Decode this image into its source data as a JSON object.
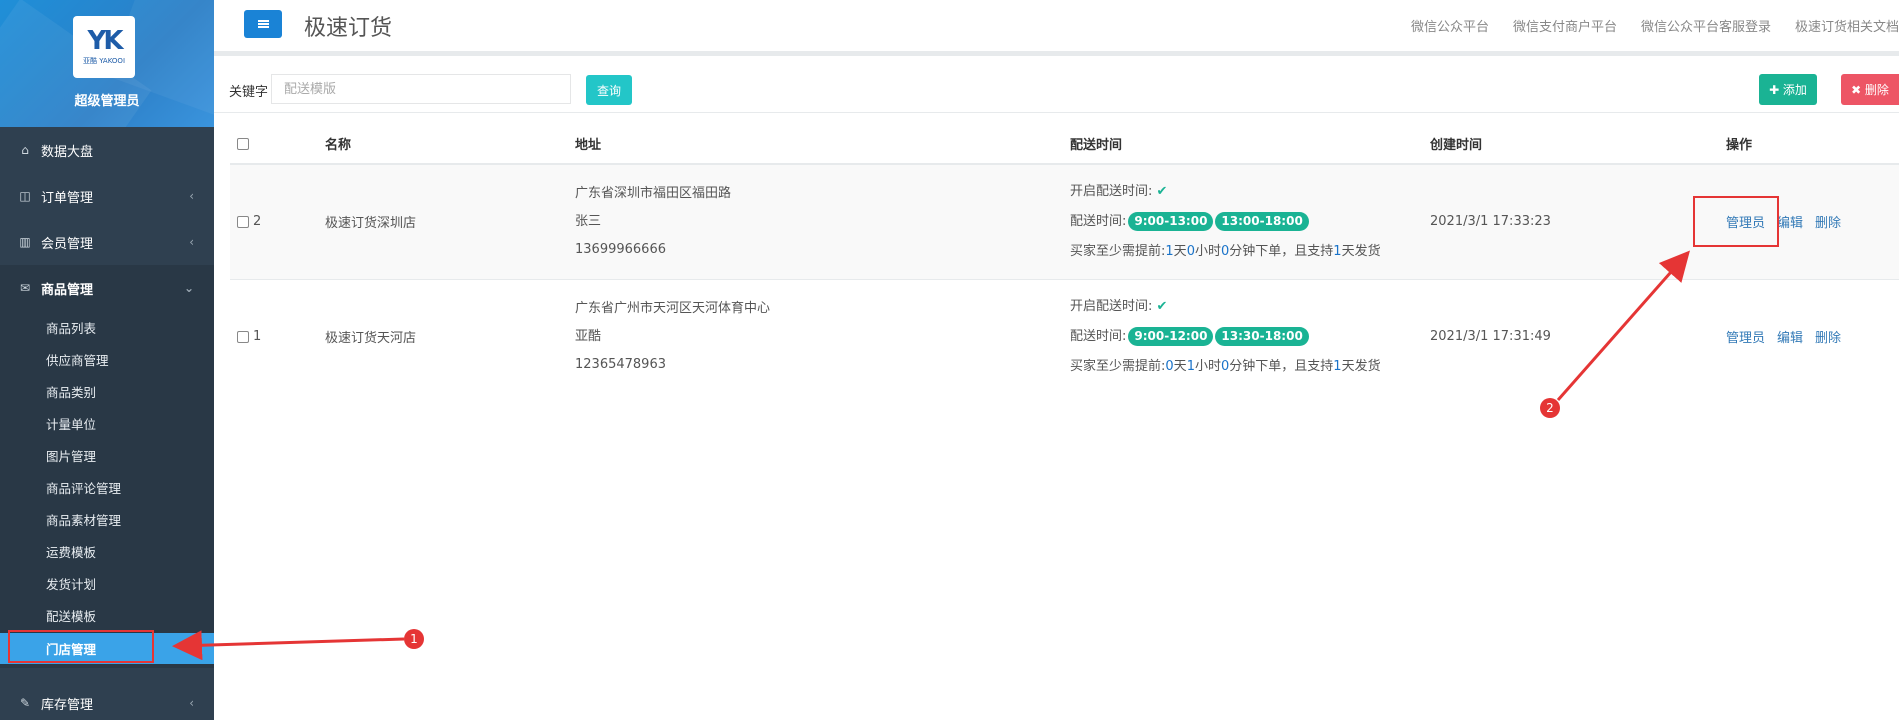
{
  "sidebar": {
    "logo_mark": "YK",
    "logo_sub": "亚酷 YAKOOI",
    "admin_name": "超级管理员",
    "items": [
      {
        "label": "数据大盘",
        "icon": "home-icon",
        "glyph": "⌂",
        "chevron": ""
      },
      {
        "label": "订单管理",
        "icon": "columns-icon",
        "glyph": "◫",
        "chevron": "‹"
      },
      {
        "label": "会员管理",
        "icon": "bar-chart-icon",
        "glyph": "▥",
        "chevron": "‹"
      },
      {
        "label": "商品管理",
        "icon": "envelope-icon",
        "glyph": "✉",
        "chevron": "⌄"
      }
    ],
    "sub_items": [
      "商品列表",
      "供应商管理",
      "商品类别",
      "计量单位",
      "图片管理",
      "商品评论管理",
      "商品素材管理",
      "运费模板",
      "发货计划",
      "配送模板",
      "门店管理"
    ],
    "bottom_item": {
      "label": "库存管理",
      "icon": "edit-icon",
      "glyph": "✎",
      "chevron": "‹"
    }
  },
  "header": {
    "title": "极速订货",
    "links": [
      "微信公众平台",
      "微信支付商户平台",
      "微信公众平台客服登录",
      "极速订货相关文档"
    ]
  },
  "filter": {
    "keyword_label": "关键字",
    "placeholder": "配送模版",
    "query_label": "查询",
    "add_label": "✚ 添加",
    "delete_label": "✖ 删除"
  },
  "table": {
    "columns": [
      "名称",
      "地址",
      "配送时间",
      "创建时间",
      "操作"
    ],
    "rows": [
      {
        "id": "2",
        "name": "极速订货深圳店",
        "address": "广东省深圳市福田区福田路",
        "contact": "张三",
        "phone": "13699966666",
        "enable_label": "开启配送时间:",
        "delivery_label": "配送时间:",
        "slots": [
          "9:00-13:00",
          "13:00-18:00"
        ],
        "advance_prefix": "买家至少需提前:",
        "days": "1",
        "hours": "0",
        "minutes": "0",
        "ship_days": "1",
        "created": "2021/3/1 17:33:23",
        "ops": [
          "管理员",
          "编辑",
          "删除"
        ]
      },
      {
        "id": "1",
        "name": "极速订货天河店",
        "address": "广东省广州市天河区天河体育中心",
        "contact": "亚酷",
        "phone": "12365478963",
        "enable_label": "开启配送时间:",
        "delivery_label": "配送时间:",
        "slots": [
          "9:00-12:00",
          "13:30-18:00"
        ],
        "advance_prefix": "买家至少需提前:",
        "days": "0",
        "hours": "1",
        "minutes": "0",
        "ship_days": "1",
        "created": "2021/3/1 17:31:49",
        "ops": [
          "管理员",
          "编辑",
          "删除"
        ]
      }
    ],
    "unit_day": "天",
    "unit_hour": "小时",
    "unit_minute": "分钟下单，且支持",
    "unit_ship": "天发货"
  },
  "annotations": {
    "badge1": "1",
    "badge2": "2",
    "color": "#e53535"
  }
}
